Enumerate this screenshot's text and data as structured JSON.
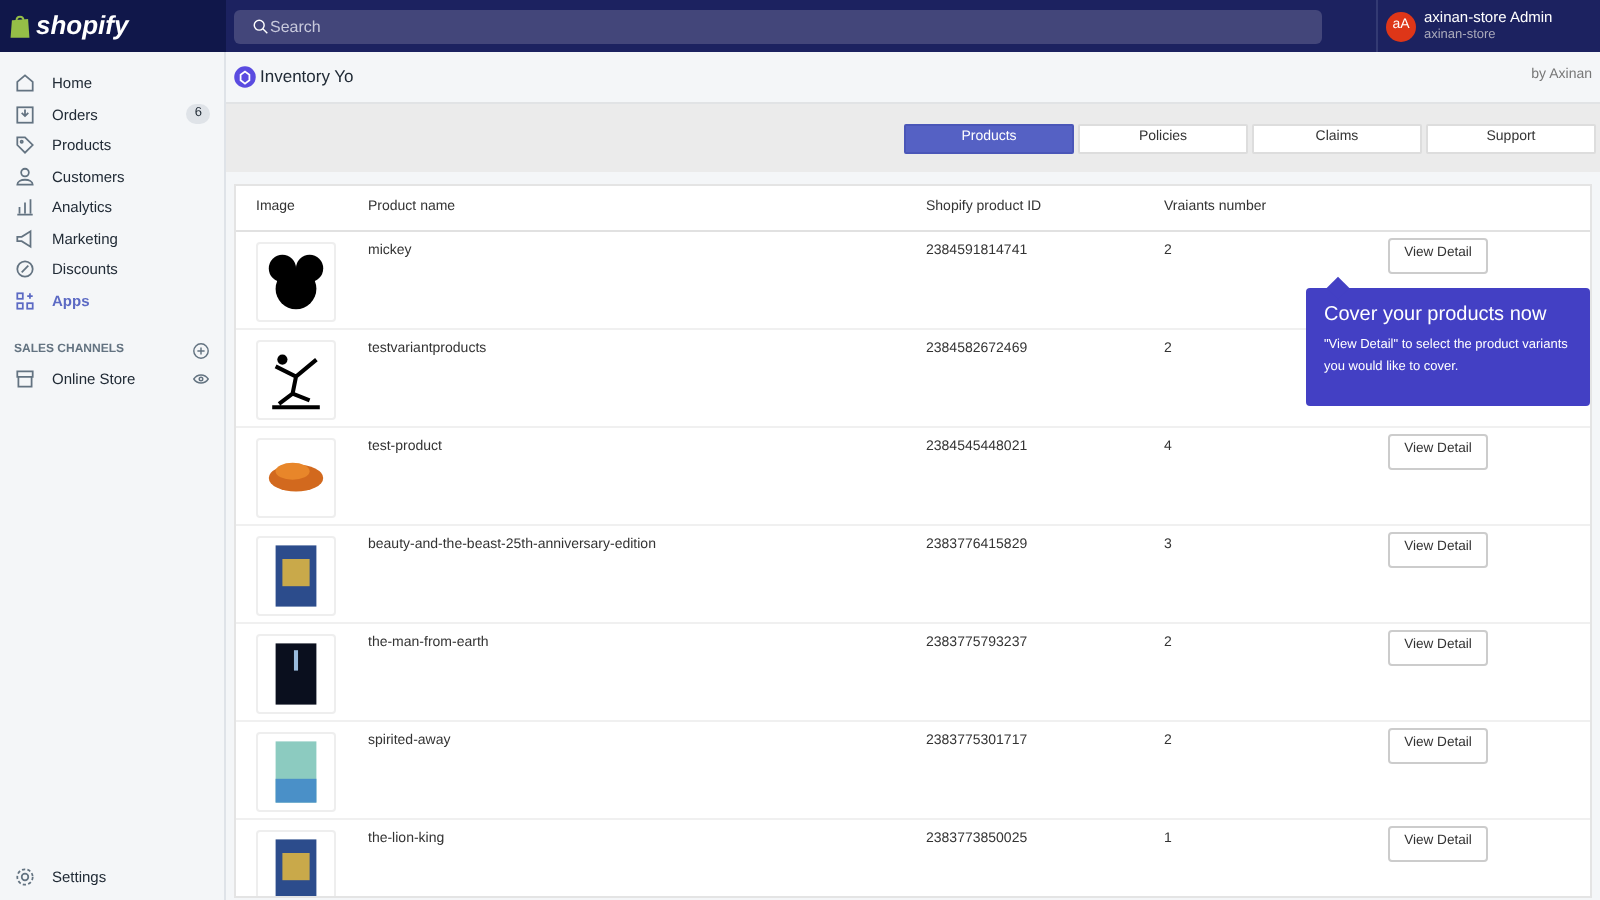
{
  "topbar": {
    "brand": "shopify",
    "search": {
      "placeholder": "Search"
    },
    "user": {
      "initials": "aA",
      "name": "axinan-store Admin",
      "store": "axinan-store"
    }
  },
  "sidebar": {
    "items": [
      {
        "label": "Home",
        "selected": false
      },
      {
        "label": "Orders",
        "selected": false,
        "badge": "6"
      },
      {
        "label": "Products",
        "selected": false
      },
      {
        "label": "Customers",
        "selected": false
      },
      {
        "label": "Analytics",
        "selected": false
      },
      {
        "label": "Marketing",
        "selected": false
      },
      {
        "label": "Discounts",
        "selected": false
      },
      {
        "label": "Apps",
        "selected": true
      }
    ],
    "section_heading": "SALES CHANNELS",
    "channels": [
      {
        "label": "Online Store",
        "selected": false
      }
    ],
    "settings": {
      "label": "Settings",
      "selected": false
    }
  },
  "app": {
    "title": "Inventory Yo",
    "byline": "by Axinan",
    "tabs": [
      {
        "label": "Products",
        "selected": true
      },
      {
        "label": "Policies",
        "selected": false
      },
      {
        "label": "Claims",
        "selected": false
      },
      {
        "label": "Support",
        "selected": false
      }
    ],
    "table": {
      "columns": [
        "Image",
        "Product name",
        "Shopify product ID",
        "Vraiants number"
      ],
      "rows": [
        {
          "name": "mickey",
          "id": "2384591814741",
          "variants": "2",
          "button": "View Detail"
        },
        {
          "name": "testvariantproducts",
          "id": "2384582672469",
          "variants": "2"
        },
        {
          "name": "test-product",
          "id": "2384545448021",
          "variants": "4",
          "button": "View Detail"
        },
        {
          "name": "beauty-and-the-beast-25th-anniversary-edition",
          "id": "2383776415829",
          "variants": "3",
          "button": "View Detail"
        },
        {
          "name": "the-man-from-earth",
          "id": "2383775793237",
          "variants": "2",
          "button": "View Detail"
        },
        {
          "name": "spirited-away",
          "id": "2383775301717",
          "variants": "2",
          "button": "View Detail"
        },
        {
          "name": "the-lion-king",
          "id": "2383773850025",
          "variants": "1",
          "button": "View Detail"
        }
      ]
    },
    "tooltip": {
      "title": "Cover your products now",
      "text": "\"View Detail\" to select the product variants you would like to cover."
    }
  }
}
